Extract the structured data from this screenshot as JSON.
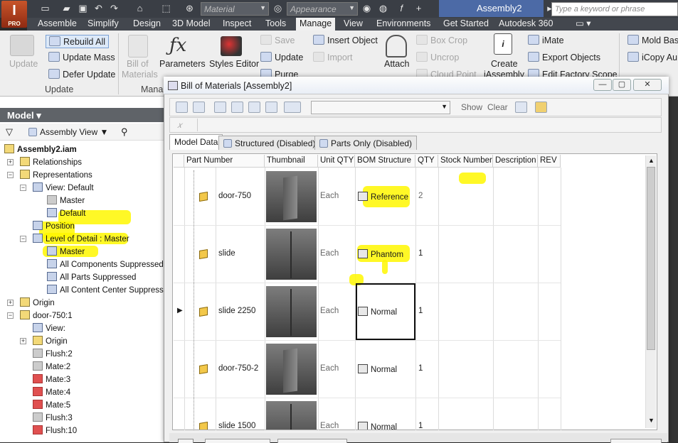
{
  "app": {
    "logo_text": "I",
    "logo_sub": "PRO",
    "document_title": "Assembly2",
    "search_placeholder": "Type a keyword or phrase"
  },
  "quick_access": {
    "material_combo": "Material",
    "appearance_combo": "Appearance"
  },
  "tabs": [
    "Assemble",
    "Simplify",
    "Design",
    "3D Model",
    "Inspect",
    "Tools",
    "Manage",
    "View",
    "Environments",
    "Get Started",
    "Autodesk 360"
  ],
  "active_tab": "Manage",
  "ribbon": {
    "update": "Update",
    "rebuild_all": "Rebuild All",
    "update_mass": "Update Mass",
    "defer_update": "Defer Update",
    "bill_of_materials_1": "Bill of",
    "bill_of_materials_2": "Materials",
    "parameters": "Parameters",
    "styles_editor": "Styles Editor",
    "save": "Save",
    "update2": "Update",
    "purge": "Purge",
    "insert_object": "Insert Object",
    "import": "Import",
    "attach": "Attach",
    "box_crop": "Box Crop",
    "uncrop": "Uncrop",
    "cloud_point": "Cloud Point",
    "create_1": "Create",
    "create_2": "iAssembly",
    "imate": "iMate",
    "export_objects": "Export Objects",
    "edit_factory_scope": "Edit Factory Scope",
    "mold_base": "Mold Bas",
    "icopy": "iCopy Au",
    "panel_update": "Update",
    "panel_manage": "Mana"
  },
  "browser": {
    "header": "Model",
    "assembly_view": "Assembly View",
    "tree": [
      "Assembly2.iam",
      "Relationships",
      "Representations",
      "View: Default",
      "Master",
      "Default",
      "Position",
      "Level of Detail : Master",
      "Master",
      "All Components Suppressed",
      "All Parts Suppressed",
      "All Content Center Suppresse",
      "Origin",
      "door-750:1",
      "View:",
      "Origin",
      "Flush:2",
      "Mate:2",
      "Mate:3",
      "Mate:4",
      "Mate:5",
      "Flush:3",
      "Flush:10"
    ]
  },
  "dialog": {
    "title": "Bill of Materials [Assembly2]",
    "show": "Show",
    "clear": "Clear",
    "tabs": [
      "Model Data",
      "Structured (Disabled)",
      "Parts Only (Disabled)"
    ],
    "columns": [
      "Part Number",
      "Thumbnail",
      "Unit QTY",
      "BOM Structure",
      "QTY",
      "Stock Number",
      "Description",
      "REV"
    ],
    "rows": [
      {
        "part": "door-750",
        "unit": "Each",
        "bom": "Reference",
        "qty": "2"
      },
      {
        "part": "slide",
        "unit": "Each",
        "bom": "Phantom",
        "qty": "1"
      },
      {
        "part": "slide 2250",
        "unit": "Each",
        "bom": "Normal",
        "qty": "1"
      },
      {
        "part": "door-750-2",
        "unit": "Each",
        "bom": "Normal",
        "qty": "1"
      },
      {
        "part": "slide 1500",
        "unit": "Each",
        "bom": "Normal",
        "qty": "1"
      }
    ]
  },
  "colors": {
    "highlight": "#fff700",
    "active_tab": "#f0f0f0",
    "title_bar": "#4c6aa6"
  }
}
